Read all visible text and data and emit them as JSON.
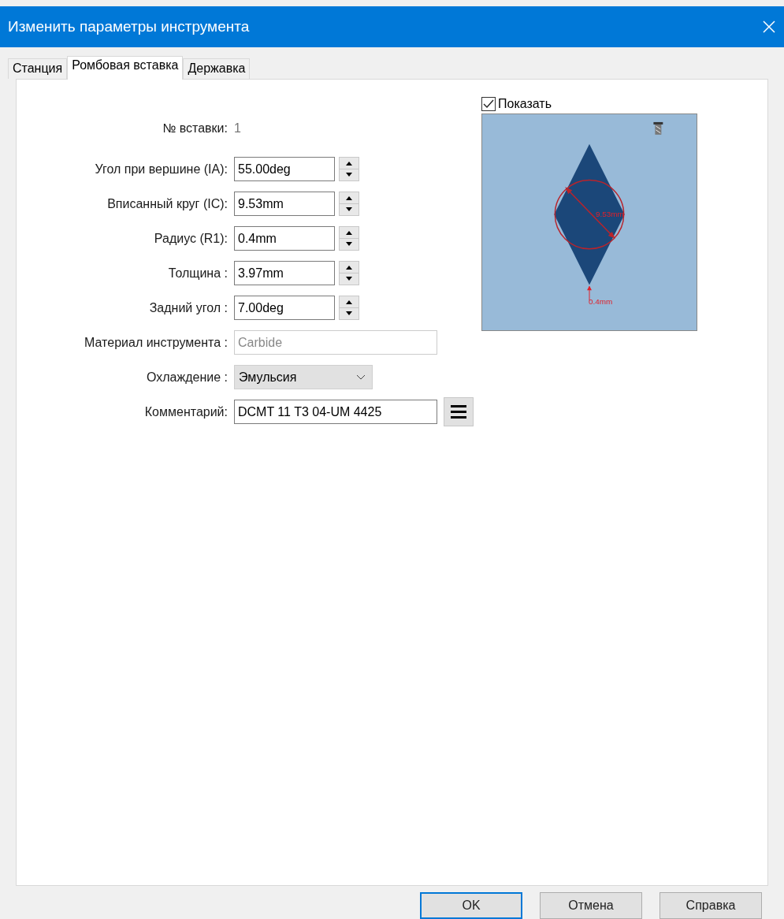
{
  "window": {
    "title": "Изменить параметры инструмента"
  },
  "tabs": [
    {
      "label": "Станция",
      "selected": false
    },
    {
      "label": "Ромбовая вставка",
      "selected": true
    },
    {
      "label": "Державка",
      "selected": false
    }
  ],
  "fields": [
    {
      "kind": "info",
      "label": "№ вставки:",
      "value": "1"
    },
    {
      "kind": "spin",
      "label": "Угол при вершине (IA):",
      "value": "55.00deg"
    },
    {
      "kind": "spin",
      "label": "Вписанный круг (IC):",
      "value": "9.53mm"
    },
    {
      "kind": "spin",
      "label": "Радиус (R1):",
      "value": "0.4mm"
    },
    {
      "kind": "spin",
      "label": "Толщина :",
      "value": "3.97mm"
    },
    {
      "kind": "spin",
      "label": "Задний угол :",
      "value": "7.00deg"
    },
    {
      "kind": "disabled",
      "label": "Материал инструмента :",
      "value": "Carbide"
    },
    {
      "kind": "dropdown",
      "label": "Охлаждение :",
      "value": "Эмульсия"
    },
    {
      "kind": "text_menu",
      "label": "Комментарий:",
      "value": "DCMT 11 T3 04-UM 4425"
    }
  ],
  "preview": {
    "show": {
      "label": "Показать",
      "checked": true
    },
    "circle_label": "9.53mm",
    "radius_label": "0.4mm"
  },
  "buttons": [
    {
      "label": "OK",
      "default": true
    },
    {
      "label": "Отмена",
      "default": false
    },
    {
      "label": "Справка",
      "default": false
    }
  ]
}
